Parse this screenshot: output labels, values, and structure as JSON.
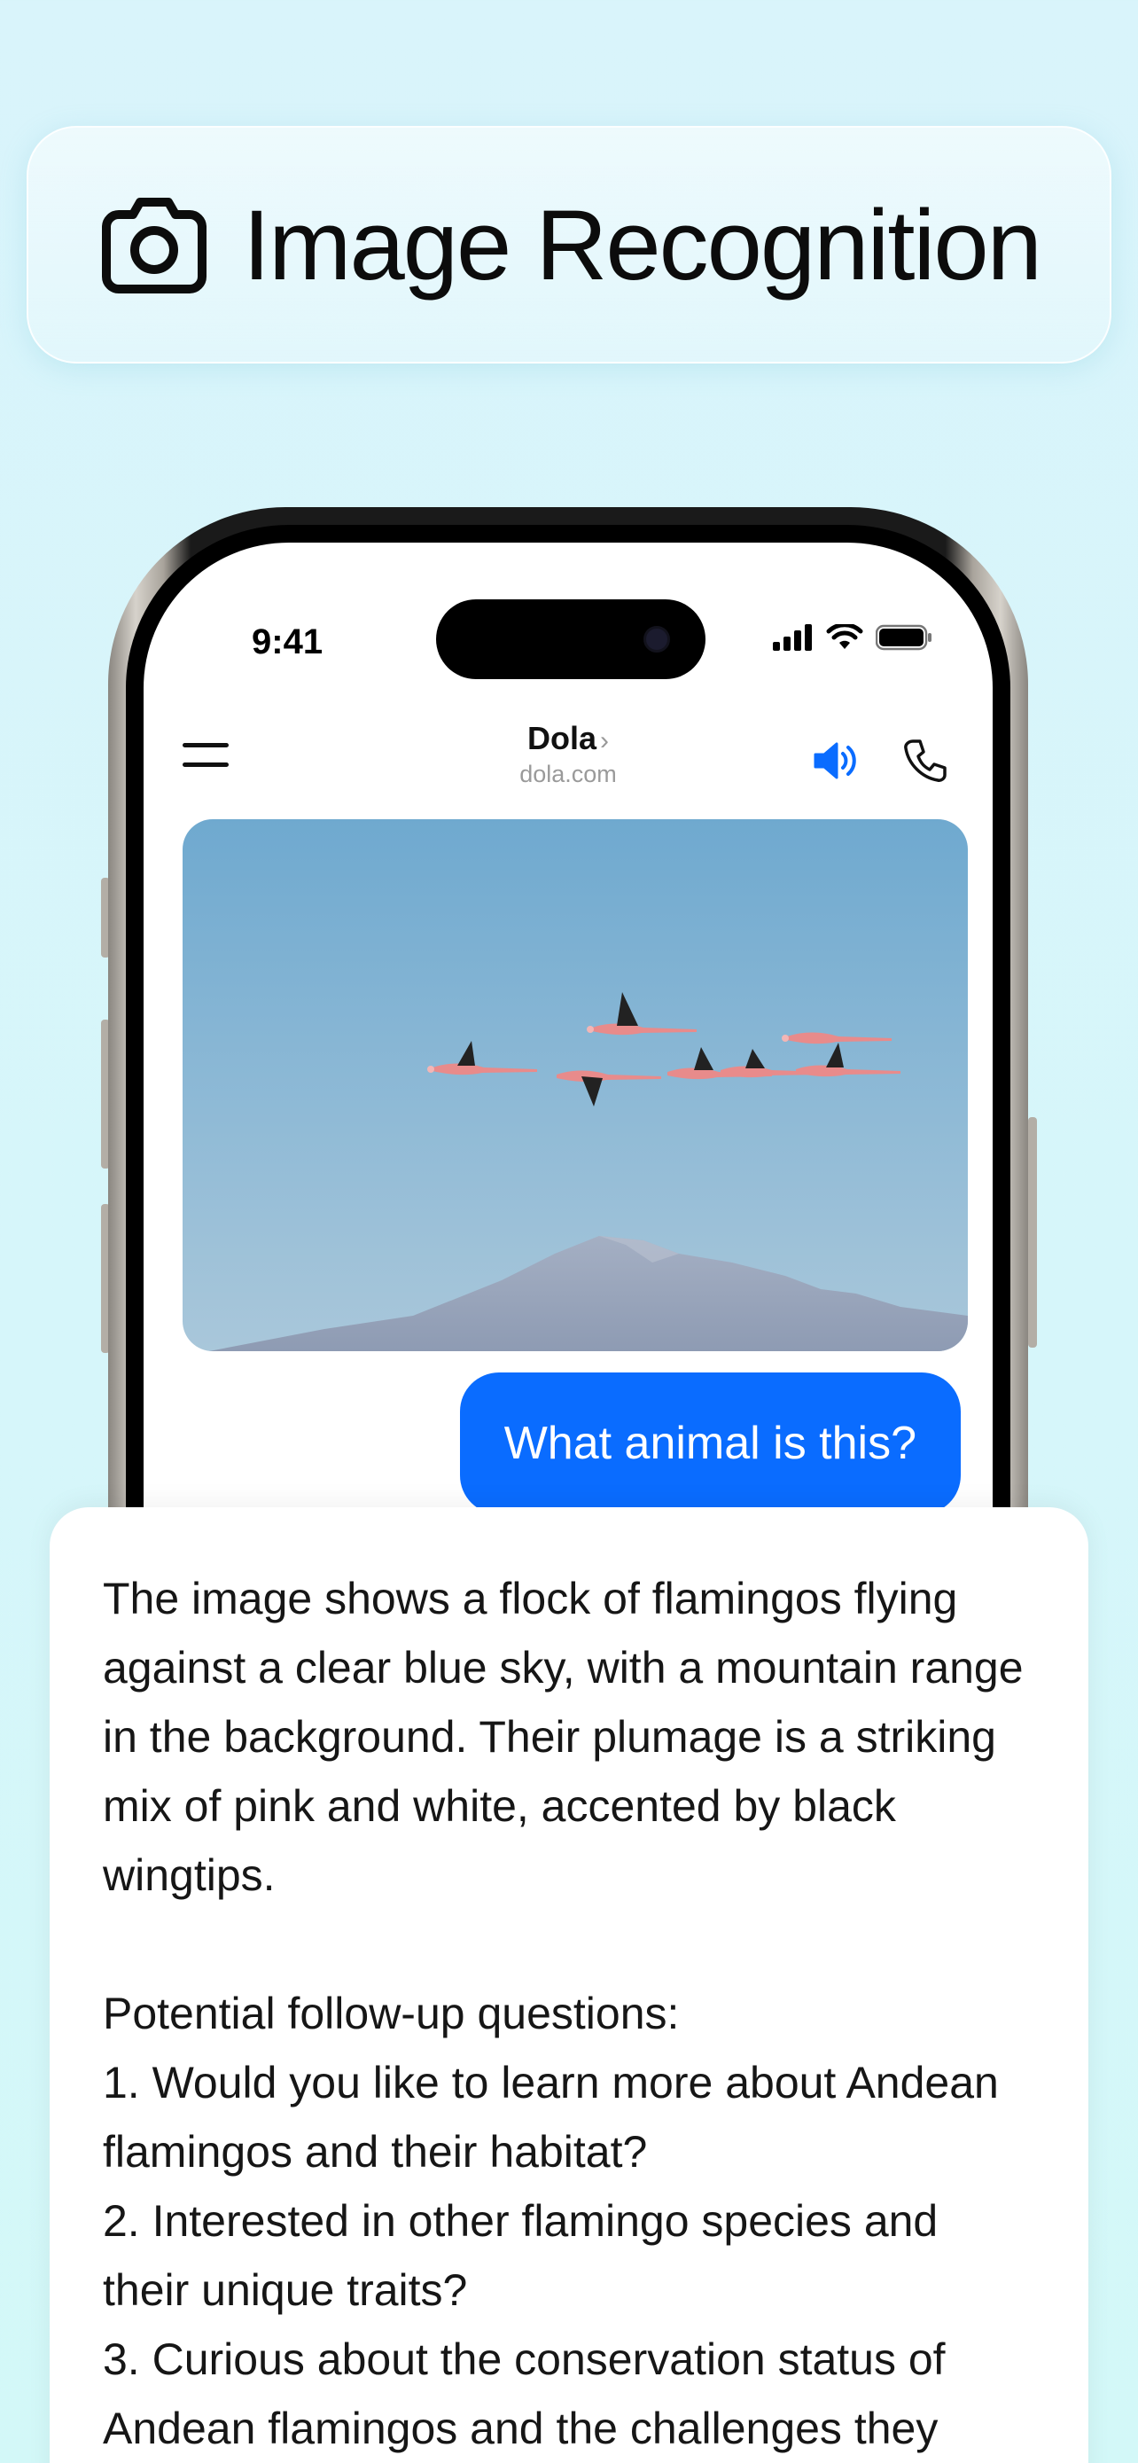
{
  "header": {
    "title": "Image Recognition",
    "icon": "camera-icon"
  },
  "status_bar": {
    "time": "9:41",
    "icons": [
      "cellular-signal-icon",
      "wifi-icon",
      "battery-icon"
    ]
  },
  "nav": {
    "title": "Dola",
    "subtitle": "dola.com",
    "chevron": "›",
    "accent_color": "#0a6cff",
    "icons": [
      "menu-icon",
      "speaker-icon",
      "phone-icon"
    ]
  },
  "chat": {
    "user_message": "What animal is this?",
    "image": "flamingos-flying-photo"
  },
  "answer": {
    "paragraph": "The image shows a flock of flamingos flying against a clear blue sky, with a mountain range in the background. Their plumage is a striking mix of pink and white, accented by black wingtips.",
    "followup_heading": "Potential follow-up questions:",
    "followups": [
      "1. Would you like to learn more about Andean flamingos and their habitat?",
      "2. Interested in other flamingo species and their unique traits?",
      "3. Curious about the conservation status of Andean flamingos and the challenges they"
    ]
  }
}
